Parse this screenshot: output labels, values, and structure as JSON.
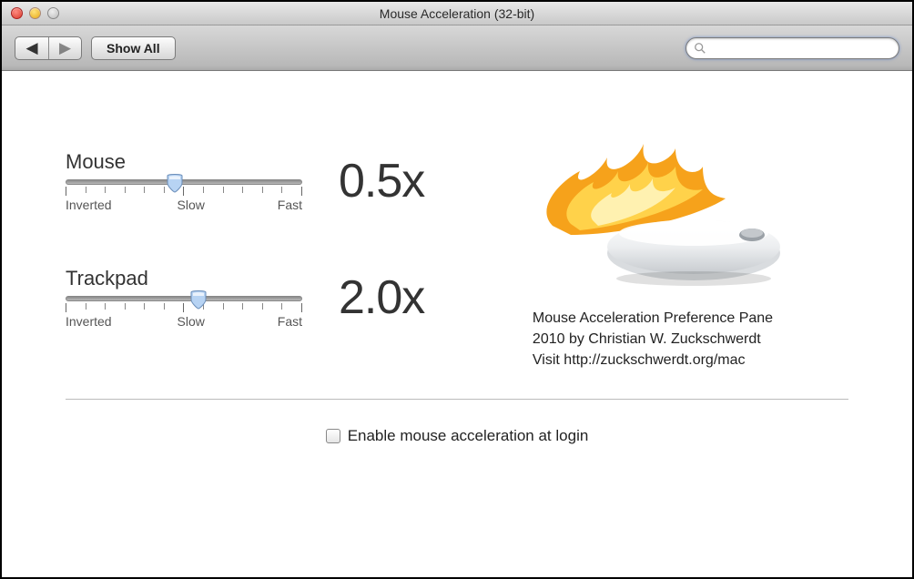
{
  "window": {
    "title": "Mouse Acceleration (32-bit)"
  },
  "toolbar": {
    "showall_label": "Show All",
    "search_placeholder": ""
  },
  "sliders": {
    "mouse": {
      "label": "Mouse",
      "value_text": "0.5x",
      "position_pct": 46,
      "tick_labels": {
        "left": "Inverted",
        "mid": "Slow",
        "right": "Fast"
      }
    },
    "trackpad": {
      "label": "Trackpad",
      "value_text": "2.0x",
      "position_pct": 56,
      "tick_labels": {
        "left": "Inverted",
        "mid": "Slow",
        "right": "Fast"
      }
    }
  },
  "credit": {
    "line1": "Mouse Acceleration Preference Pane",
    "line2": "2010 by Christian W. Zuckschwerdt",
    "line3": "Visit http://zuckschwerdt.org/mac"
  },
  "login_checkbox": {
    "label": "Enable mouse acceleration at login",
    "checked": false
  }
}
